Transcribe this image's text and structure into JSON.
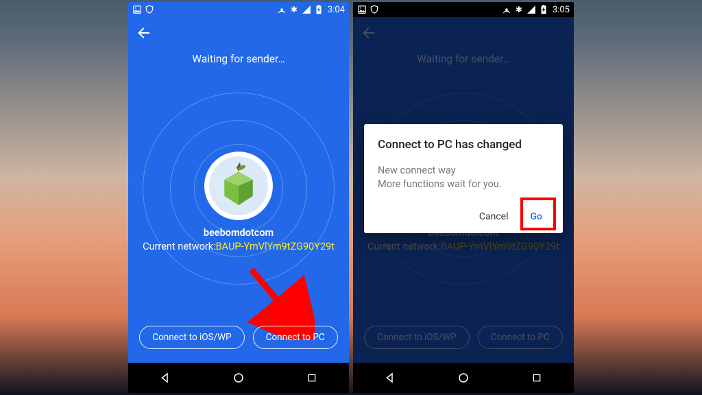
{
  "left": {
    "status": {
      "time": "3:04"
    },
    "waiting": "Waiting for sender…",
    "username": "beebomdotcom",
    "network_label": "Current network:",
    "network_value": "BAUP-YmVlYm9tZG90Y29t",
    "btn_ios": "Connect to iOS/WP",
    "btn_pc": "Connect to PC"
  },
  "right": {
    "status": {
      "time": "3:05"
    },
    "waiting": "Waiting for sender…",
    "username": "beebomdotcom",
    "network_label": "Current network:",
    "network_value": "BAUP-YmVlYm9tZG90Y29t",
    "btn_ios": "Connect to iOS/WP",
    "btn_pc": "Connect to PC",
    "dialog": {
      "title": "Connect to PC has changed",
      "line1": "New connect way",
      "line2": "More functions wait for you.",
      "cancel": "Cancel",
      "go": "Go"
    }
  }
}
